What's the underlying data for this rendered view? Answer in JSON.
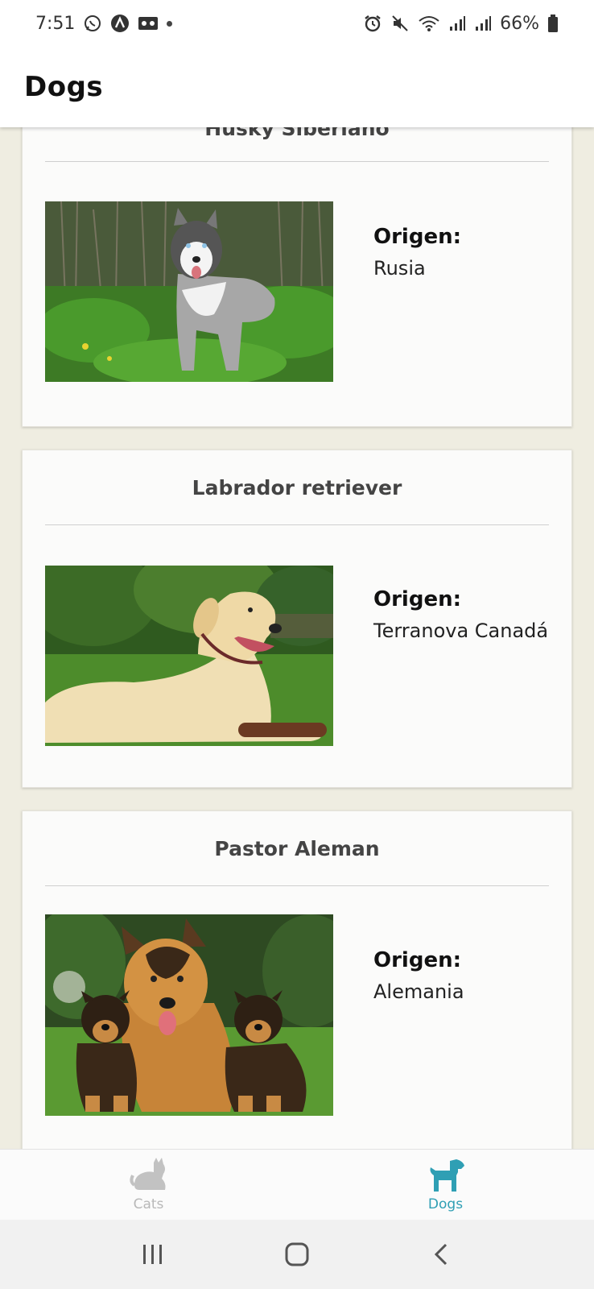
{
  "status_bar": {
    "time": "7:51",
    "battery": "66%",
    "left_icons": [
      "whatsapp-icon",
      "app-a-icon",
      "voicemail-icon"
    ],
    "right_icons": [
      "alarm-icon",
      "mute-icon",
      "wifi-icon",
      "signal-icon",
      "signal-icon",
      "battery-icon"
    ]
  },
  "app_bar": {
    "title": "Dogs"
  },
  "cards": [
    {
      "title": "Husky Siberiano",
      "origin_label": "Origen:",
      "origin_value": "Rusia"
    },
    {
      "title": "Labrador retriever",
      "origin_label": "Origen:",
      "origin_value": "Terranova Canadá"
    },
    {
      "title": "Pastor Aleman",
      "origin_label": "Origen:",
      "origin_value": "Alemania"
    }
  ],
  "bottom_nav": {
    "items": [
      {
        "label": "Cats",
        "icon": "cat-icon",
        "active": false
      },
      {
        "label": "Dogs",
        "icon": "dog-icon",
        "active": true
      }
    ]
  },
  "colors": {
    "accent": "#2f9fb4",
    "inactive": "#b8b8b8",
    "background": "#efede1",
    "card": "#fbfbfa"
  },
  "system_nav": {
    "icons": [
      "recent-apps-icon",
      "home-icon",
      "back-icon"
    ]
  }
}
